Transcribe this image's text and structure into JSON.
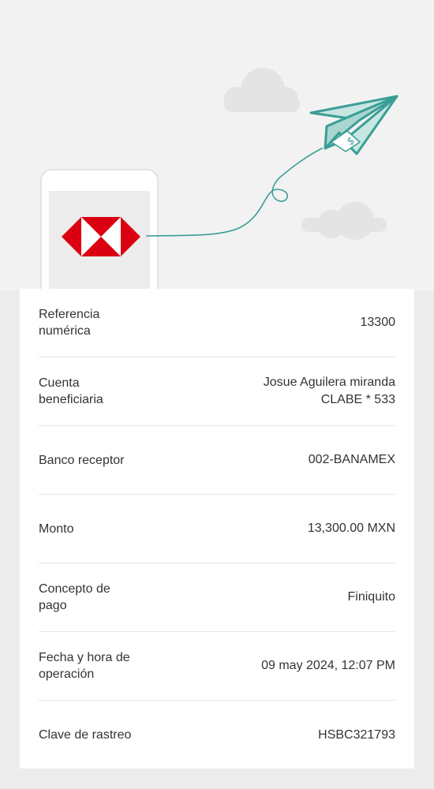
{
  "brand": {
    "logo_icon": "hsbc-hexagon-logo",
    "red": "#db0011",
    "teal": "#3a9e96"
  },
  "illustration": {
    "icons": [
      "phone-icon",
      "paper-plane-icon",
      "cloud-icon",
      "dollar-icon"
    ]
  },
  "details": [
    {
      "label": "Referencia numérica",
      "value": "13300"
    },
    {
      "label": "Cuenta beneficiaria",
      "value": "Josue Aguilera miranda\nCLABE * 533"
    },
    {
      "label": "Banco receptor",
      "value": "002-BANAMEX"
    },
    {
      "label": "Monto",
      "value": "13,300.00 MXN"
    },
    {
      "label": "Concepto de pago",
      "value": "Finiquito"
    },
    {
      "label": "Fecha y hora de operación",
      "value": "09 may 2024, 12:07 PM"
    },
    {
      "label": "Clave de rastreo",
      "value": "HSBC321793"
    }
  ]
}
